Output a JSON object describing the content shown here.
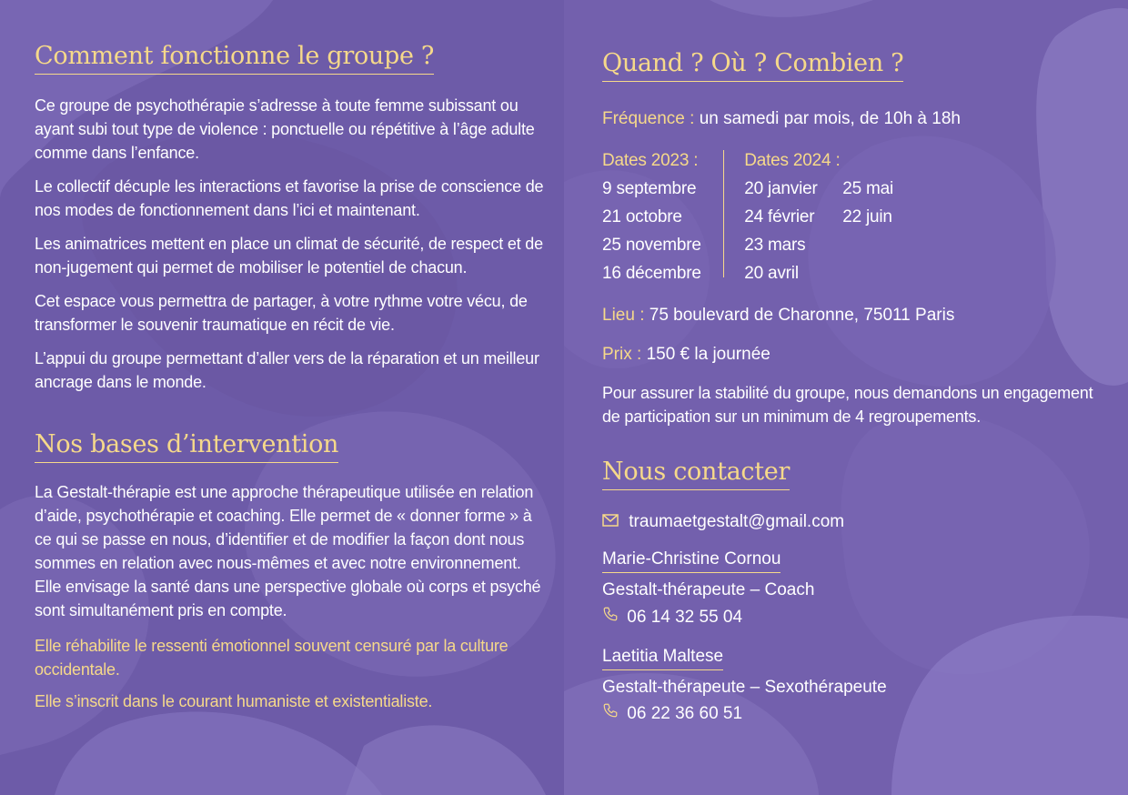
{
  "left": {
    "section1": {
      "title": "Comment fonctionne le groupe ?",
      "paragraphs": [
        "Ce groupe de psychothérapie s’adresse à toute femme subissant ou ayant subi tout type de violence : ponctuelle ou répétitive à l’âge adulte comme dans l’enfance.",
        "Le collectif décuple les interactions et favorise la prise de conscience de nos modes de fonctionnement dans l’ici et maintenant.",
        "Les animatrices mettent en place un climat de sécurité, de respect et de non-jugement qui permet de mobiliser le potentiel de chacun.",
        "Cet espace vous permettra de partager, à votre rythme votre vécu, de transformer le souvenir traumatique en récit de vie.",
        "L’appui du groupe permettant d’aller vers de la réparation et un meilleur ancrage dans le monde."
      ]
    },
    "section2": {
      "title": "Nos bases d’intervention",
      "paragraph": "La Gestalt-thérapie est une approche thérapeutique utilisée en relation d’aide, psychothérapie et coaching. Elle permet de « donner forme » à ce qui se passe en nous, d’identifier et de modifier la façon dont nous sommes en relation avec nous-mêmes et avec notre environnement. Elle envisage la santé dans une perspective globale où corps et psyché sont simultanément pris en compte.",
      "highlight1": "Elle réhabilite le ressenti émotionnel souvent censuré par la culture occidentale.",
      "highlight2": "Elle s’inscrit dans le courant humaniste et existentialiste."
    }
  },
  "right": {
    "section3": {
      "title": "Quand ? Où ? Combien ?",
      "frequence_label": "Fréquence :",
      "frequence_value": "un samedi par mois, de 10h à 18h",
      "dates2023_label": "Dates 2023 :",
      "dates2023": [
        "9 septembre",
        "21 octobre",
        "25 novembre",
        "16 décembre"
      ],
      "dates2024_label": "Dates 2024 :",
      "dates2024_col1": [
        "20 janvier",
        "24 février",
        "23 mars",
        "20 avril"
      ],
      "dates2024_col2": [
        "25 mai",
        "22 juin"
      ],
      "lieu_label": "Lieu :",
      "lieu_value": "75 boulevard de Charonne, 75011 Paris",
      "prix_label": "Prix :",
      "prix_value": "150 € la journée",
      "engagement": "Pour assurer la stabilité du groupe, nous demandons un engagement de participation sur un minimum de 4 regroupements."
    },
    "section4": {
      "title": "Nous contacter",
      "email": "traumaetgestalt@gmail.com",
      "contacts": [
        {
          "name": "Marie-Christine Cornou",
          "role": "Gestalt-thérapeute – Coach",
          "phone": "06 14 32 55 04"
        },
        {
          "name": "Laetitia Maltese",
          "role": "Gestalt-thérapeute – Sexothérapeute",
          "phone": "06 22 36 60 51"
        }
      ]
    }
  },
  "colors": {
    "background": "#6c5aa6",
    "accent": "#f6d98a",
    "text": "#ffffff"
  },
  "icons": {
    "email": "envelope-icon",
    "phone": "phone-icon"
  }
}
